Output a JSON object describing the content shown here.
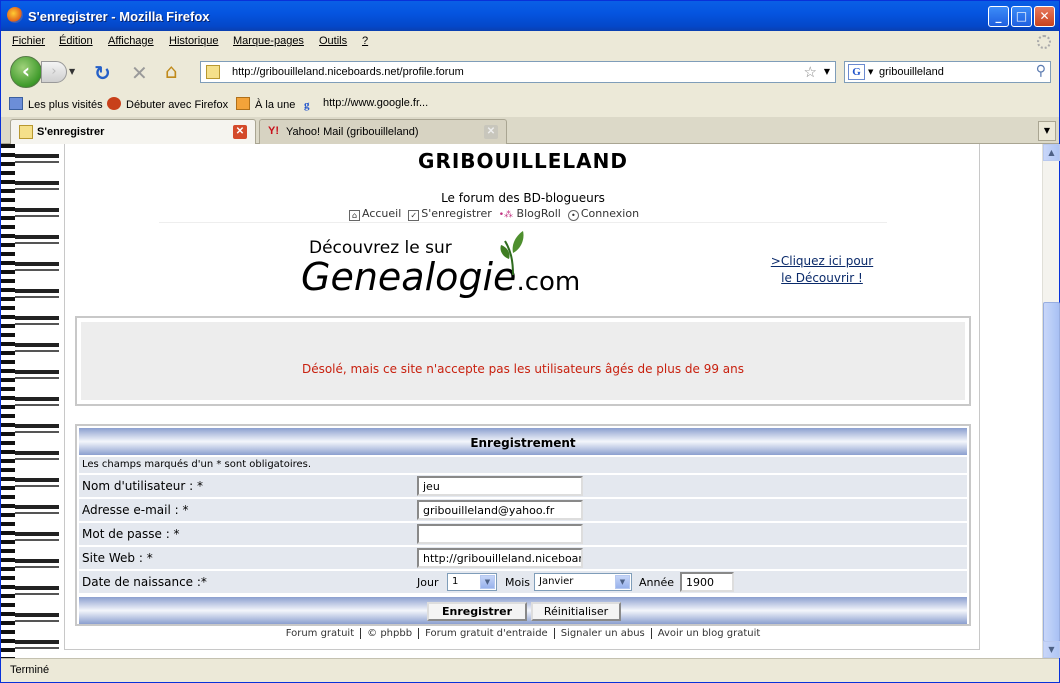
{
  "window": {
    "title": "S'enregistrer - Mozilla Firefox"
  },
  "menu": [
    "Fichier",
    "Édition",
    "Affichage",
    "Historique",
    "Marque-pages",
    "Outils",
    "?"
  ],
  "nav": {
    "url": "http://gribouilleland.niceboards.net/profile.forum",
    "search_engine": "G",
    "search_query": "gribouilleland"
  },
  "bookmarks": [
    "Les plus visités",
    "Débuter avec Firefox",
    "À la une",
    "http://www.google.fr..."
  ],
  "tabs": [
    {
      "label": "S'enregistrer",
      "active": true
    },
    {
      "label": "Yahoo! Mail (gribouilleland)",
      "active": false
    }
  ],
  "page": {
    "site_title": "GRIBOUILLELAND",
    "subtitle": "Le forum des BD-blogueurs",
    "nav_links": [
      "Accueil",
      "S'enregistrer",
      "BlogRoll",
      "Connexion"
    ],
    "ad": {
      "line1": "Découvrez le sur",
      "brand": "Genealogie",
      "brand_suffix": ".com",
      "cta_line1": ">Cliquez ici pour",
      "cta_line2": "le Découvrir !"
    },
    "error_message": "Désolé, mais ce site n'accepte pas les utilisateurs âgés de plus de 99 ans",
    "form": {
      "header": "Enregistrement",
      "required_note": "Les champs marqués d'un * sont obligatoires.",
      "username_label": "Nom d'utilisateur : *",
      "username_value": "jeu",
      "email_label": "Adresse e-mail : *",
      "email_value": "gribouilleland@yahoo.fr",
      "password_label": "Mot de passe : *",
      "password_value": "",
      "website_label": "Site Web : *",
      "website_value": "http://gribouilleland.niceboards.net",
      "birth_label": "Date de naissance :*",
      "day_label": "Jour",
      "day_value": "1",
      "month_label": "Mois",
      "month_value": "Janvier",
      "year_label": "Année",
      "year_value": "1900",
      "submit_label": "Enregistrer",
      "reset_label": "Réinitialiser"
    },
    "footer_links": [
      "Forum gratuit",
      "© phpbb",
      "Forum gratuit d'entraide",
      "Signaler un abus",
      "Avoir un blog gratuit"
    ]
  },
  "status": {
    "text": "Terminé"
  },
  "colors": {
    "error": "#c8200e",
    "form_header": "#8b9fcf",
    "xp_blue": "#0555e0"
  }
}
